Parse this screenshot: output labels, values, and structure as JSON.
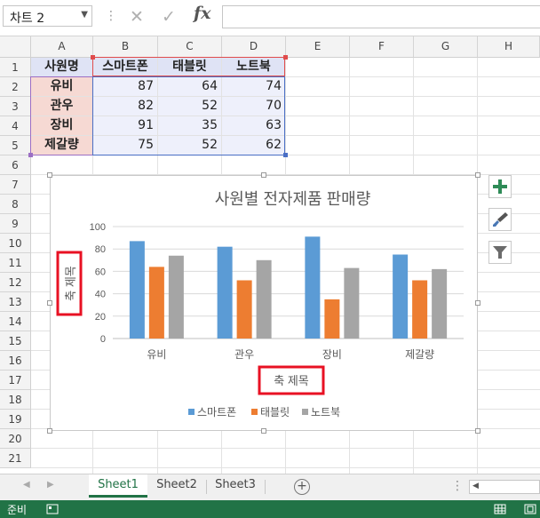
{
  "formula_bar": {
    "name_box": "차트 2",
    "formula": ""
  },
  "columns": [
    "A",
    "B",
    "C",
    "D",
    "E",
    "F",
    "G",
    "H"
  ],
  "rows": [
    "1",
    "2",
    "3",
    "4",
    "5",
    "6",
    "7",
    "8",
    "9",
    "10",
    "11",
    "12",
    "13",
    "14",
    "15",
    "16",
    "17",
    "18",
    "19",
    "20",
    "21"
  ],
  "table": {
    "headers": [
      "사원명",
      "스마트폰",
      "태블릿",
      "노트북"
    ],
    "rows": [
      {
        "name": "유비",
        "values": [
          87,
          64,
          74
        ]
      },
      {
        "name": "관우",
        "values": [
          82,
          52,
          70
        ]
      },
      {
        "name": "장비",
        "values": [
          91,
          35,
          63
        ]
      },
      {
        "name": "제갈량",
        "values": [
          75,
          52,
          62
        ]
      }
    ]
  },
  "chart_data": {
    "type": "bar",
    "title": "사원별 전자제품 판매량",
    "xlabel": "축 제목",
    "ylabel": "축 제목",
    "categories": [
      "유비",
      "관우",
      "장비",
      "제갈량"
    ],
    "ylim": [
      0,
      100
    ],
    "yticks": [
      0,
      20,
      40,
      60,
      80,
      100
    ],
    "grid": true,
    "legend": "bottom",
    "series": [
      {
        "name": "스마트폰",
        "values": [
          87,
          82,
          91,
          75
        ],
        "color": "#5b9bd5"
      },
      {
        "name": "태블릿",
        "values": [
          64,
          52,
          35,
          52
        ],
        "color": "#ed7d31"
      },
      {
        "name": "노트북",
        "values": [
          74,
          70,
          63,
          62
        ],
        "color": "#a5a5a5"
      }
    ]
  },
  "sheet_tabs": [
    "Sheet1",
    "Sheet2",
    "Sheet3"
  ],
  "active_sheet": "Sheet1",
  "status": {
    "mode": "준비"
  },
  "colors": {
    "highlight": "#e81123",
    "status_bar": "#217346",
    "tab_active": "#217346"
  }
}
